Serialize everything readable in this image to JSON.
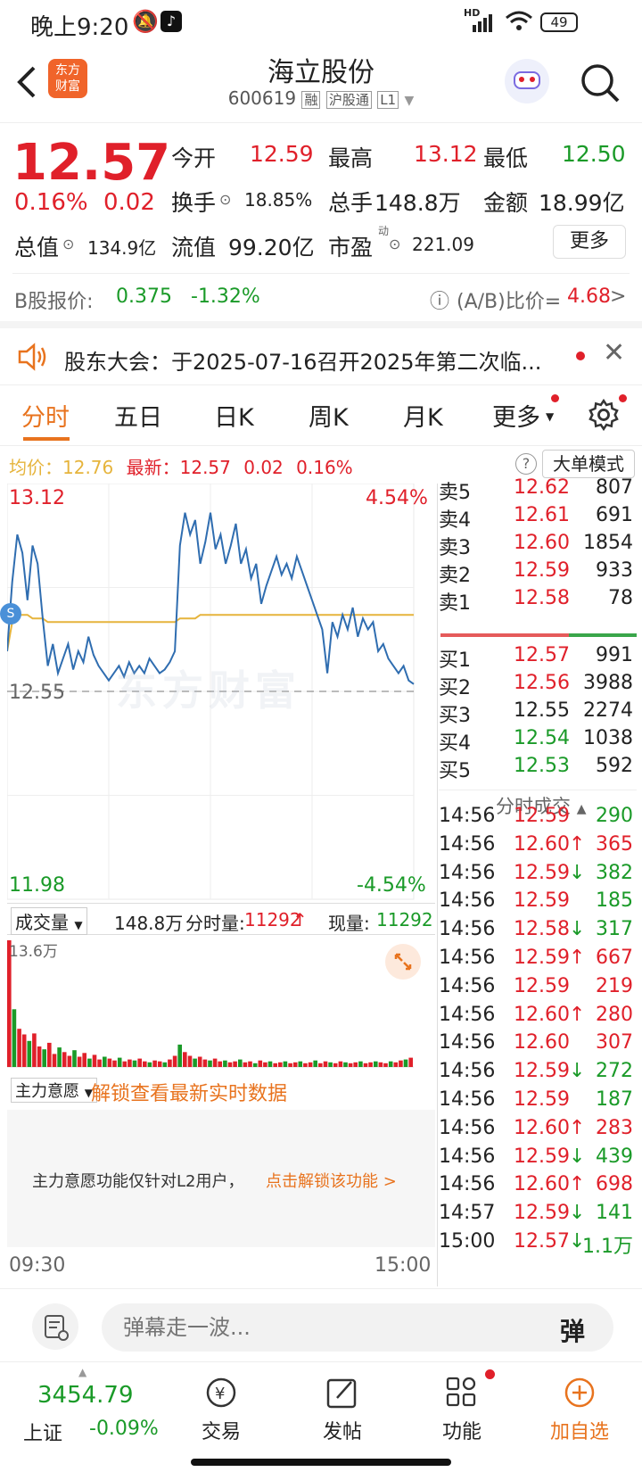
{
  "status": {
    "time": "晚上9:20",
    "battery": "49",
    "net": "HD"
  },
  "header": {
    "title": "海立股份",
    "code": "600619",
    "tags": [
      "融",
      "沪股通",
      "L1"
    ],
    "brand_line1": "东方",
    "brand_line2": "财富"
  },
  "quote": {
    "price": "12.57",
    "change_pct": "0.16%",
    "change": "0.02",
    "open_label": "今开",
    "open": "12.59",
    "high_label": "最高",
    "high": "13.12",
    "low_label": "最低",
    "low": "12.50",
    "turnover_label": "换手",
    "turnover": "18.85%",
    "volume_label": "总手",
    "volume": "148.8万",
    "amount_label": "金额",
    "amount": "18.99亿",
    "mktcap_label": "总值",
    "mktcap": "134.9亿",
    "float_label": "流值",
    "float": "99.20亿",
    "pe_label": "市盈",
    "pe_sup": "动",
    "pe": "221.09",
    "more": "更多"
  },
  "bshare": {
    "label": "B股报价:",
    "price": "0.375",
    "change": "-1.32%",
    "ratio_label": "(A/B)比价=",
    "ratio": "4.68",
    "arrow": ">"
  },
  "notice": {
    "text": "股东大会：于2025-07-16召开2025年第二次临..."
  },
  "tabs": [
    "分时",
    "五日",
    "日K",
    "周K",
    "月K",
    "更多"
  ],
  "chart_info": {
    "avg_label": "均价：",
    "avg": "12.76",
    "last_label": "最新：",
    "last": "12.57",
    "chg": "0.02",
    "pct": "0.16%",
    "mode": "大单模式",
    "help": "?"
  },
  "chart_data": {
    "type": "line",
    "y_max": "13.12",
    "y_min": "11.98",
    "pct_max": "4.54%",
    "pct_min": "-4.54%",
    "prev_close": "12.55",
    "ylim": [
      11.98,
      13.12
    ],
    "x_start": "09:30",
    "x_end": "15:00",
    "watermark": "东方财富",
    "price": [
      12.66,
      12.85,
      12.98,
      12.93,
      12.8,
      12.95,
      12.9,
      12.75,
      12.62,
      12.68,
      12.6,
      12.64,
      12.68,
      12.61,
      12.66,
      12.63,
      12.7,
      12.65,
      12.62,
      12.6,
      12.58,
      12.6,
      12.62,
      12.59,
      12.63,
      12.6,
      12.62,
      12.6,
      12.64,
      12.62,
      12.6,
      12.61,
      12.63,
      12.66,
      12.95,
      13.04,
      12.98,
      13.02,
      12.9,
      12.96,
      13.04,
      12.94,
      12.98,
      12.9,
      12.95,
      13.01,
      12.9,
      12.94,
      12.86,
      12.9,
      12.79,
      12.84,
      12.88,
      12.92,
      12.87,
      12.9,
      12.86,
      12.92,
      12.88,
      12.84,
      12.8,
      12.76,
      12.72,
      12.6,
      12.74,
      12.7,
      12.76,
      12.72,
      12.78,
      12.7,
      12.75,
      12.72,
      12.74,
      12.66,
      12.68,
      12.64,
      12.62,
      12.6,
      12.62,
      12.58,
      12.57
    ],
    "avg": [
      12.66,
      12.74,
      12.76,
      12.76,
      12.76,
      12.75,
      12.75,
      12.75,
      12.74,
      12.74,
      12.74,
      12.74,
      12.74,
      12.74,
      12.74,
      12.74,
      12.74,
      12.74,
      12.74,
      12.74,
      12.74,
      12.74,
      12.74,
      12.74,
      12.74,
      12.74,
      12.74,
      12.74,
      12.74,
      12.74,
      12.74,
      12.74,
      12.74,
      12.74,
      12.75,
      12.75,
      12.75,
      12.75,
      12.76,
      12.76,
      12.76,
      12.76,
      12.76,
      12.76,
      12.76,
      12.76,
      12.76,
      12.76,
      12.76,
      12.76,
      12.76,
      12.76,
      12.76,
      12.76,
      12.76,
      12.76,
      12.76,
      12.76,
      12.76,
      12.76,
      12.76,
      12.76,
      12.76,
      12.76,
      12.76,
      12.76,
      12.76,
      12.76,
      12.76,
      12.76,
      12.76,
      12.76,
      12.76,
      12.76,
      12.76,
      12.76,
      12.76,
      12.76,
      12.76,
      12.76,
      12.76
    ]
  },
  "vol_info": {
    "label": "成交量",
    "total": "148.8万",
    "min_label": "分时量:",
    "min_vol": "11292",
    "now_label": "现量:",
    "now_vol": "11292",
    "ymax": "13.6万"
  },
  "volume_bars": [
    13.6,
    6.2,
    4.1,
    3.5,
    2.8,
    3.6,
    2.2,
    1.9,
    2.6,
    1.4,
    2.1,
    1.6,
    1.2,
    1.8,
    1.1,
    1.5,
    0.9,
    1.3,
    0.8,
    1.1,
    0.9,
    0.7,
    1.0,
    0.6,
    0.8,
    0.7,
    0.9,
    0.6,
    0.5,
    0.7,
    0.6,
    0.5,
    0.8,
    1.2,
    2.4,
    1.6,
    1.2,
    0.9,
    1.1,
    0.8,
    0.7,
    0.9,
    0.6,
    0.7,
    0.5,
    0.6,
    0.8,
    0.5,
    0.6,
    0.4,
    0.7,
    0.5,
    0.6,
    0.4,
    0.5,
    0.6,
    0.4,
    0.5,
    0.6,
    0.4,
    0.5,
    0.7,
    0.4,
    0.6,
    0.5,
    0.4,
    0.6,
    0.5,
    0.4,
    0.5,
    0.6,
    0.4,
    0.5,
    0.6,
    0.5,
    0.4,
    0.6,
    0.5,
    0.7,
    0.8,
    1.0
  ],
  "main_intent": {
    "label": "主力意愿",
    "unlock": "解锁查看最新实时数据",
    "tip": "主力意愿功能仅针对L2用户，",
    "tip_link": "点击解锁该功能 >"
  },
  "orderbook": {
    "asks": [
      {
        "label": "卖5",
        "price": "12.62",
        "vol": "807"
      },
      {
        "label": "卖4",
        "price": "12.61",
        "vol": "691"
      },
      {
        "label": "卖3",
        "price": "12.60",
        "vol": "1854"
      },
      {
        "label": "卖2",
        "price": "12.59",
        "vol": "933"
      },
      {
        "label": "卖1",
        "price": "12.58",
        "vol": "78"
      }
    ],
    "bids": [
      {
        "label": "买1",
        "price": "12.57",
        "vol": "991"
      },
      {
        "label": "买2",
        "price": "12.56",
        "vol": "3988"
      },
      {
        "label": "买3",
        "price": "12.55",
        "vol": "2274"
      },
      {
        "label": "买4",
        "price": "12.54",
        "vol": "1038"
      },
      {
        "label": "买5",
        "price": "12.53",
        "vol": "592"
      }
    ]
  },
  "trades_title": "分时成交",
  "trades": [
    {
      "time": "14:56",
      "price": "12.59",
      "arrow": "",
      "vol": "290",
      "pc": "red",
      "vc": "green"
    },
    {
      "time": "14:56",
      "price": "12.60",
      "arrow": "↑",
      "vol": "365",
      "pc": "red",
      "vc": "red"
    },
    {
      "time": "14:56",
      "price": "12.59",
      "arrow": "↓",
      "vol": "382",
      "pc": "red",
      "vc": "green"
    },
    {
      "time": "14:56",
      "price": "12.59",
      "arrow": "",
      "vol": "185",
      "pc": "red",
      "vc": "green"
    },
    {
      "time": "14:56",
      "price": "12.58",
      "arrow": "↓",
      "vol": "317",
      "pc": "red",
      "vc": "green"
    },
    {
      "time": "14:56",
      "price": "12.59",
      "arrow": "↑",
      "vol": "667",
      "pc": "red",
      "vc": "red"
    },
    {
      "time": "14:56",
      "price": "12.59",
      "arrow": "",
      "vol": "219",
      "pc": "red",
      "vc": "red"
    },
    {
      "time": "14:56",
      "price": "12.60",
      "arrow": "↑",
      "vol": "280",
      "pc": "red",
      "vc": "red"
    },
    {
      "time": "14:56",
      "price": "12.60",
      "arrow": "",
      "vol": "307",
      "pc": "red",
      "vc": "red"
    },
    {
      "time": "14:56",
      "price": "12.59",
      "arrow": "↓",
      "vol": "272",
      "pc": "red",
      "vc": "green"
    },
    {
      "time": "14:56",
      "price": "12.59",
      "arrow": "",
      "vol": "187",
      "pc": "red",
      "vc": "green"
    },
    {
      "time": "14:56",
      "price": "12.60",
      "arrow": "↑",
      "vol": "283",
      "pc": "red",
      "vc": "red"
    },
    {
      "time": "14:56",
      "price": "12.59",
      "arrow": "↓",
      "vol": "439",
      "pc": "red",
      "vc": "green"
    },
    {
      "time": "14:56",
      "price": "12.60",
      "arrow": "↑",
      "vol": "698",
      "pc": "red",
      "vc": "red"
    },
    {
      "time": "14:57",
      "price": "12.59",
      "arrow": "↓",
      "vol": "141",
      "pc": "red",
      "vc": "green"
    },
    {
      "time": "15:00",
      "price": "12.57",
      "arrow": "↓",
      "vol": "1.1万",
      "pc": "red",
      "vc": "green"
    }
  ],
  "comment": {
    "placeholder": "弹幕走一波...",
    "btn": "弹"
  },
  "nav": {
    "index_value": "3454.79",
    "index_name": "上证",
    "index_change": "-0.09%",
    "trade": "交易",
    "post": "发帖",
    "func": "功能",
    "add": "加自选"
  },
  "colors": {
    "red": "#e0202a",
    "green": "#1a9a28",
    "orange": "#e8731e",
    "line": "#2f6db0",
    "avg": "#e6b43c"
  }
}
